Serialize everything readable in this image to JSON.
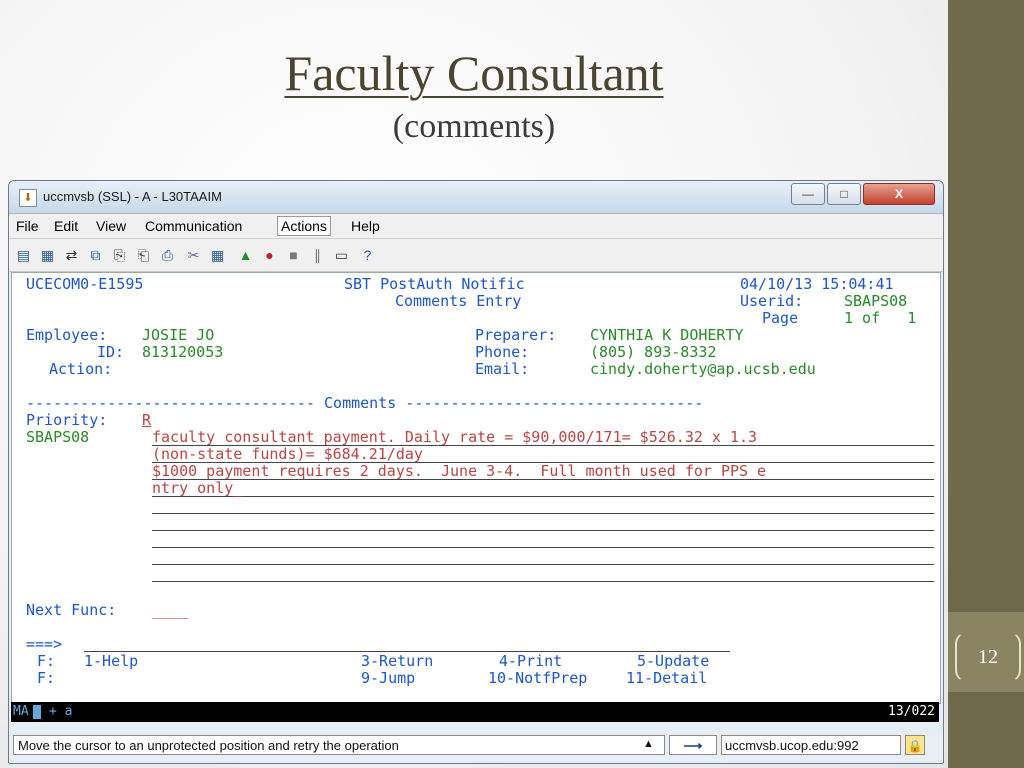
{
  "slide": {
    "title": "Faculty Consultant",
    "subtitle": "(comments)",
    "page_number": "12"
  },
  "window": {
    "title": "uccmvsb (SSL) - A - L30TAAIM",
    "minimize": "—",
    "maximize": "□",
    "close": "X"
  },
  "menu": [
    "File",
    "Edit",
    "View",
    "Communication",
    "Actions",
    "Help"
  ],
  "terminal": {
    "screen_id": "UCECOM0-E1595",
    "system_title": "SBT PostAuth Notific",
    "screen_title": "Comments Entry",
    "datetime": "04/10/13 15:04:41",
    "userid_label": "Userid:",
    "userid": "SBAPS08",
    "page_label": "Page",
    "page_value": "1 of   1",
    "employee_label": "Employee:",
    "employee": "JOSIE JO",
    "id_label": "ID:",
    "id": "813120053",
    "action_label": "Action:",
    "preparer_label": "Preparer:",
    "preparer": "CYNTHIA K DOHERTY",
    "phone_label": "Phone:",
    "phone": "(805) 893-8332",
    "email_label": "Email:",
    "email": "cindy.doherty@ap.ucsb.edu",
    "separator": "-------------------------------- Comments ---------------------------------",
    "priority_label": "Priority:",
    "priority": "R",
    "comment_user": "SBAPS08",
    "comment_lines": [
      "faculty consultant payment. Daily rate = $90,000/171= $526.32 x 1.3",
      "(non-state funds)= $684.21/day",
      "$1000 payment requires 2 days.  June 3-4.  Full month used for PPS e",
      "ntry only_",
      "",
      "",
      "",
      "",
      ""
    ],
    "next_func_label": "Next Func:",
    "next_func": "____",
    "command_prompt": "===>",
    "fkeys_1_label": "F:",
    "fkeys_1": [
      "1-Help",
      "3-Return",
      "4-Print",
      "5-Update"
    ],
    "fkeys_2_label": "F:",
    "fkeys_2": [
      "9-Jump",
      "10-NotfPrep",
      "11-Detail"
    ]
  },
  "oia": {
    "left": "MA",
    "mid": "+   a",
    "cursor_pos": "13/022"
  },
  "status": {
    "message": "Move the cursor to an unprotected position and retry the operation",
    "host": "uccmvsb.ucop.edu:992"
  }
}
